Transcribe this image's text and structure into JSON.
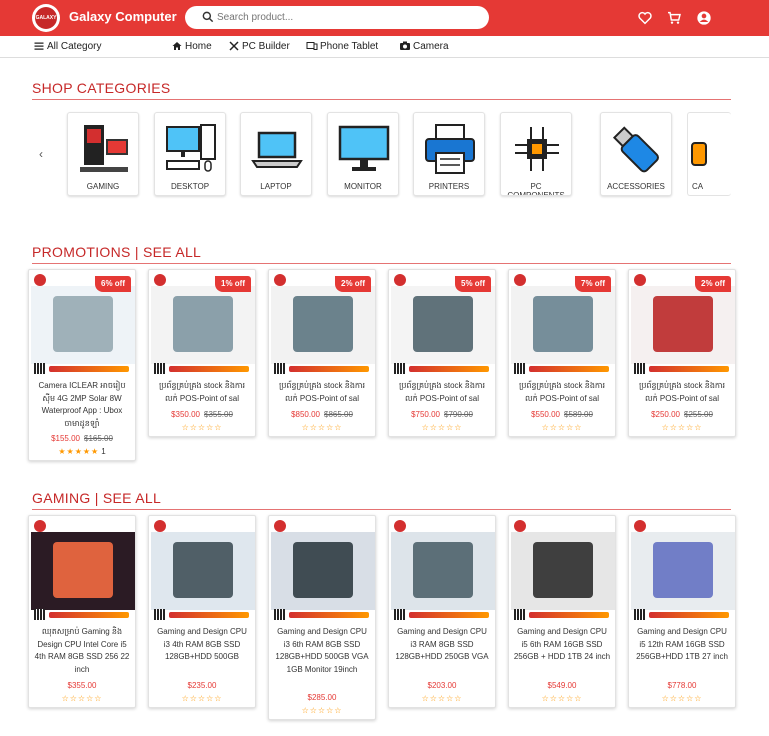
{
  "header": {
    "brand": "Galaxy Computer",
    "logo_text": "GALAXY",
    "search_placeholder": "Search product...",
    "icons": [
      "heart-icon",
      "cart-icon",
      "account-icon"
    ],
    "color": "#e53935"
  },
  "nav": {
    "all_category": "All Category",
    "items": [
      "Home",
      "PC Builder",
      "Phone Tablet",
      "Camera"
    ]
  },
  "categories": {
    "title": "SHOP CATEGORIES",
    "items": [
      "GAMING",
      "DESKTOP",
      "LAPTOP",
      "MONITOR",
      "PRINTERS",
      "PC COMPONENTS",
      "ACCESSORIES",
      "CA"
    ]
  },
  "promotions": {
    "title": "PROMOTIONS | SEE ALL",
    "products": [
      {
        "name": "Camera ICLEAR អាចរៀបស៊ីម 4G 2MP Solar 8W Waterproof App : Ubox ចាមាដូនឡាំ",
        "price": "$155.00",
        "old": "$165.00",
        "badge": "6% off",
        "stars": "★★★★★",
        "count": "1"
      },
      {
        "name": "ប្រព័ន្ធគ្រប់គ្រង stock និងការលក់ POS-Point of sal",
        "price": "$350.00",
        "old": "$355.00",
        "badge": "1% off",
        "stars": "☆☆☆☆☆"
      },
      {
        "name": "ប្រព័ន្ធគ្រប់គ្រង stock និងការលក់ POS-Point of sal",
        "price": "$850.00",
        "old": "$865.00",
        "badge": "2% off",
        "stars": "☆☆☆☆☆"
      },
      {
        "name": "ប្រព័ន្ធគ្រប់គ្រង stock និងការលក់ POS-Point of sal",
        "price": "$750.00",
        "old": "$790.00",
        "badge": "5% off",
        "stars": "☆☆☆☆☆"
      },
      {
        "name": "ប្រព័ន្ធគ្រប់គ្រង stock និងការលក់ POS-Point of sal",
        "price": "$550.00",
        "old": "$589.00",
        "badge": "7% off",
        "stars": "☆☆☆☆☆"
      },
      {
        "name": "ប្រព័ន្ធគ្រប់គ្រង stock និងការលក់ POS-Point of sal",
        "price": "$250.00",
        "old": "$255.00",
        "badge": "2% off",
        "stars": "☆☆☆☆☆"
      }
    ]
  },
  "gaming": {
    "title": "GAMING | SEE ALL",
    "products": [
      {
        "name": "ឈុតសម្រាប់ Gaming និង Design CPU Intel Core i5 4th RAM 8GB SSD 256 22 inch",
        "price": "$355.00",
        "stars": "☆☆☆☆☆"
      },
      {
        "name": "Gaming and Design CPU i3 4th RAM 8GB SSD 128GB+HDD 500GB",
        "price": "$235.00",
        "stars": "☆☆☆☆☆"
      },
      {
        "name": "Gaming and Design CPU i3 6th RAM 8GB SSD 128GB+HDD 500GB VGA 1GB Monitor 19inch",
        "price": "$285.00",
        "stars": "☆☆☆☆☆"
      },
      {
        "name": "Gaming and Design CPU i3 RAM 8GB SSD 128GB+HDD 250GB VGA 1GB Monitor 19inch",
        "price": "$203.00",
        "stars": "☆☆☆☆☆"
      },
      {
        "name": "Gaming and Design CPU i5 6th RAM 16GB SSD 256GB + HDD 1TB 24 inch",
        "price": "$549.00",
        "stars": "☆☆☆☆☆"
      },
      {
        "name": "Gaming and Design CPU i5 12th RAM 16GB SSD 256GB+HDD 1TB 27 inch",
        "price": "$778.00",
        "stars": "☆☆☆☆☆"
      }
    ]
  }
}
